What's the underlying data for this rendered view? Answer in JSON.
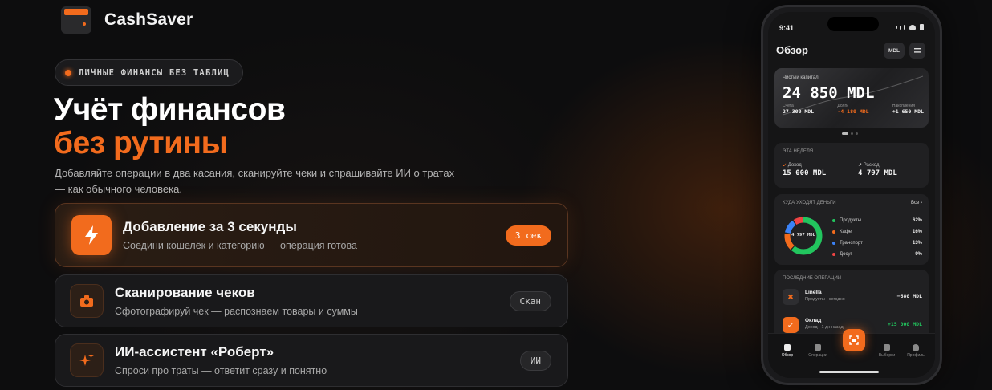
{
  "brand": {
    "name": "CashSaver"
  },
  "hero": {
    "pill": "ЛИЧНЫЕ ФИНАНСЫ БЕЗ ТАБЛИЦ",
    "title_line1": "Учёт финансов",
    "title_line2": "без рутины",
    "lead": "Добавляйте операции в два касания, сканируйте чеки и спрашивайте ИИ о тратах — как обычного человека."
  },
  "features": [
    {
      "title": "Добавление за 3 секунды",
      "subtitle": "Соедини кошелёк и категорию — операция готова",
      "badge": "3 сек",
      "icon": "lightning-icon",
      "active": true
    },
    {
      "title": "Сканирование чеков",
      "subtitle": "Сфотографируй чек — распознаем товары и суммы",
      "badge": "Скан",
      "icon": "camera-icon",
      "active": false
    },
    {
      "title": "ИИ-ассистент «Роберт»",
      "subtitle": "Спроси про траты — ответит сразу и понятно",
      "badge": "ИИ",
      "icon": "sparkle-icon",
      "active": false
    }
  ],
  "phone": {
    "time": "9:41",
    "title": "Обзор",
    "currency_button": "MDL",
    "menu_icon": "menu-icon",
    "net_worth": {
      "label": "Чистый капитал",
      "value": "24 850 MDL",
      "stats": [
        {
          "label": "Счета",
          "value": "27 300 MDL"
        },
        {
          "label": "Долги",
          "value": "-4 180 MDL"
        },
        {
          "label": "Накопления",
          "value": "+1 650 MDL"
        }
      ]
    },
    "week": {
      "label": "ЭТА НЕДЕЛЯ",
      "income_label": "Доход",
      "income_value": "15 000 MDL",
      "expense_label": "Расход",
      "expense_value": "4 797 MDL"
    },
    "spending": {
      "label": "КУДА УХОДЯТ ДЕНЬГИ",
      "all_link": "Все",
      "total": "4 797 MDL",
      "categories": [
        {
          "name": "Продукты",
          "percent": "62%",
          "value": 62,
          "color": "#22c55e"
        },
        {
          "name": "Кафе",
          "percent": "16%",
          "value": 16,
          "color": "#f26b1d"
        },
        {
          "name": "Транспорт",
          "percent": "13%",
          "value": 13,
          "color": "#3b82f6"
        },
        {
          "name": "Досуг",
          "percent": "9%",
          "value": 9,
          "color": "#ef4444"
        }
      ]
    },
    "recent": {
      "label": "ПОСЛЕДНИЕ ОПЕРАЦИИ",
      "items": [
        {
          "name": "Linella",
          "sub": "Продукты · сегодня",
          "amount": "−680 MDL",
          "color": "#f2f2f2"
        },
        {
          "name": "Оклад",
          "sub": "Доход · 1 дн назад",
          "amount": "+15 000 MDL",
          "color": "#22c55e"
        }
      ]
    },
    "nav": [
      "Обзор",
      "Операции",
      "",
      "Выборки",
      "Профиль"
    ]
  },
  "colors": {
    "accent": "#f26b1d",
    "background": "#0d0d0e"
  }
}
